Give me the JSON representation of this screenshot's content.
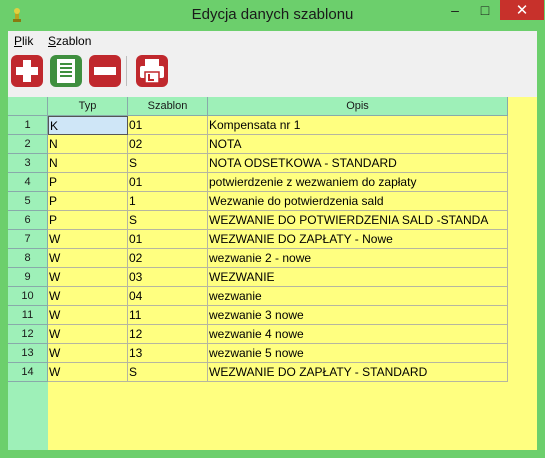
{
  "window": {
    "title": "Edycja danych szablonu"
  },
  "menu": [
    {
      "label": "Plik",
      "accel": "P",
      "rest": "lik"
    },
    {
      "label": "Szablon",
      "accel": "S",
      "rest": "zablon"
    }
  ],
  "toolbar": {
    "buttons": [
      {
        "name": "add-button",
        "icon": "plus-icon"
      },
      {
        "name": "edit-button",
        "icon": "document-icon"
      },
      {
        "name": "remove-button",
        "icon": "minus-icon"
      },
      {
        "name": "print-button",
        "icon": "printer-icon"
      }
    ]
  },
  "grid": {
    "headers": {
      "typ": "Typ",
      "szablon": "Szablon",
      "opis": "Opis"
    },
    "rows": [
      {
        "n": "1",
        "typ": "K",
        "szablon": "01",
        "opis": "Kompensata nr 1"
      },
      {
        "n": "2",
        "typ": "N",
        "szablon": "02",
        "opis": "NOTA"
      },
      {
        "n": "3",
        "typ": "N",
        "szablon": "S",
        "opis": "NOTA ODSETKOWA - STANDARD"
      },
      {
        "n": "4",
        "typ": "P",
        "szablon": "01",
        "opis": "potwierdzenie z wezwaniem do zapłaty"
      },
      {
        "n": "5",
        "typ": "P",
        "szablon": "1",
        "opis": "Wezwanie do potwierdzenia sald"
      },
      {
        "n": "6",
        "typ": "P",
        "szablon": "S",
        "opis": "WEZWANIE DO POTWIERDZENIA SALD -STANDA"
      },
      {
        "n": "7",
        "typ": "W",
        "szablon": "01",
        "opis": "WEZWANIE DO ZAPŁATY - Nowe"
      },
      {
        "n": "8",
        "typ": "W",
        "szablon": "02",
        "opis": "wezwanie 2 - nowe"
      },
      {
        "n": "9",
        "typ": "W",
        "szablon": "03",
        "opis": "WEZWANIE"
      },
      {
        "n": "10",
        "typ": "W",
        "szablon": "04",
        "opis": "wezwanie"
      },
      {
        "n": "11",
        "typ": "W",
        "szablon": "11",
        "opis": "wezwanie 3 nowe"
      },
      {
        "n": "12",
        "typ": "W",
        "szablon": "12",
        "opis": "wezwanie 4 nowe"
      },
      {
        "n": "13",
        "typ": "W",
        "szablon": "13",
        "opis": "wezwanie 5 nowe"
      },
      {
        "n": "14",
        "typ": "W",
        "szablon": "S",
        "opis": "WEZWANIE DO ZAPŁATY - STANDARD"
      }
    ]
  },
  "colors": {
    "accent_red": "#c0282d",
    "accent_green": "#3f8f3f",
    "grid_bg": "#ffff80",
    "header_bg": "#9ef0b8",
    "window_frame": "#6ccf6c"
  }
}
